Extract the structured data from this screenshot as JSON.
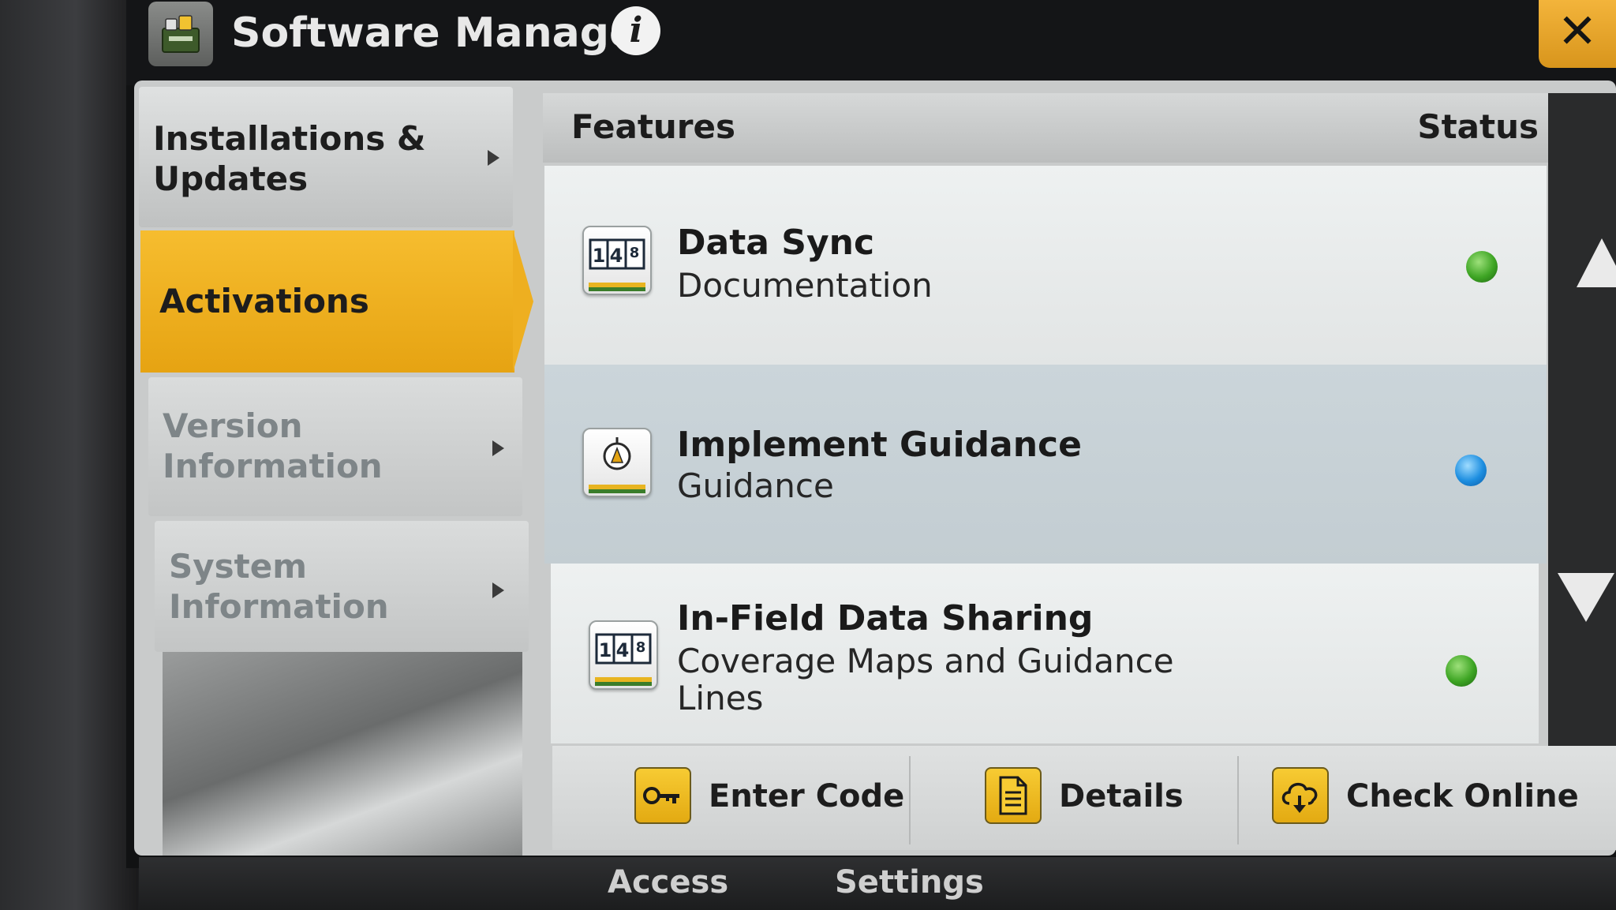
{
  "window": {
    "title": "Software Manager",
    "close_glyph": "✕"
  },
  "sidebar": {
    "items": [
      {
        "line1": "Installations &",
        "line2": "Updates",
        "state": "normal"
      },
      {
        "line1": "Activations",
        "line2": "",
        "state": "selected"
      },
      {
        "line1": "Version",
        "line2": "Information",
        "state": "dim"
      },
      {
        "line1": "System",
        "line2": "Information",
        "state": "dim"
      }
    ]
  },
  "table": {
    "headers": {
      "features": "Features",
      "status": "Status"
    },
    "rows": [
      {
        "name": "Data Sync",
        "sub1": "Documentation",
        "sub2": "",
        "icon": "counter-icon",
        "status_color": "#3ea524"
      },
      {
        "name": "Implement Guidance",
        "sub1": "Guidance",
        "sub2": "",
        "icon": "compass-icon",
        "status_color": "#1d8ee0"
      },
      {
        "name": "In-Field Data Sharing",
        "sub1": "Coverage Maps and Guidance",
        "sub2": "Lines",
        "icon": "counter-icon",
        "status_color": "#3ea524"
      }
    ],
    "counter_digits": [
      "1",
      "4",
      "8"
    ]
  },
  "actions": {
    "enter_code": "Enter Code",
    "details": "Details",
    "check_online": "Check Online"
  },
  "bottom_tabs": {
    "left": "Access",
    "right": "Settings"
  },
  "colors": {
    "accent": "#eeaf20",
    "status_active": "#3ea524",
    "status_info": "#1d8ee0"
  }
}
